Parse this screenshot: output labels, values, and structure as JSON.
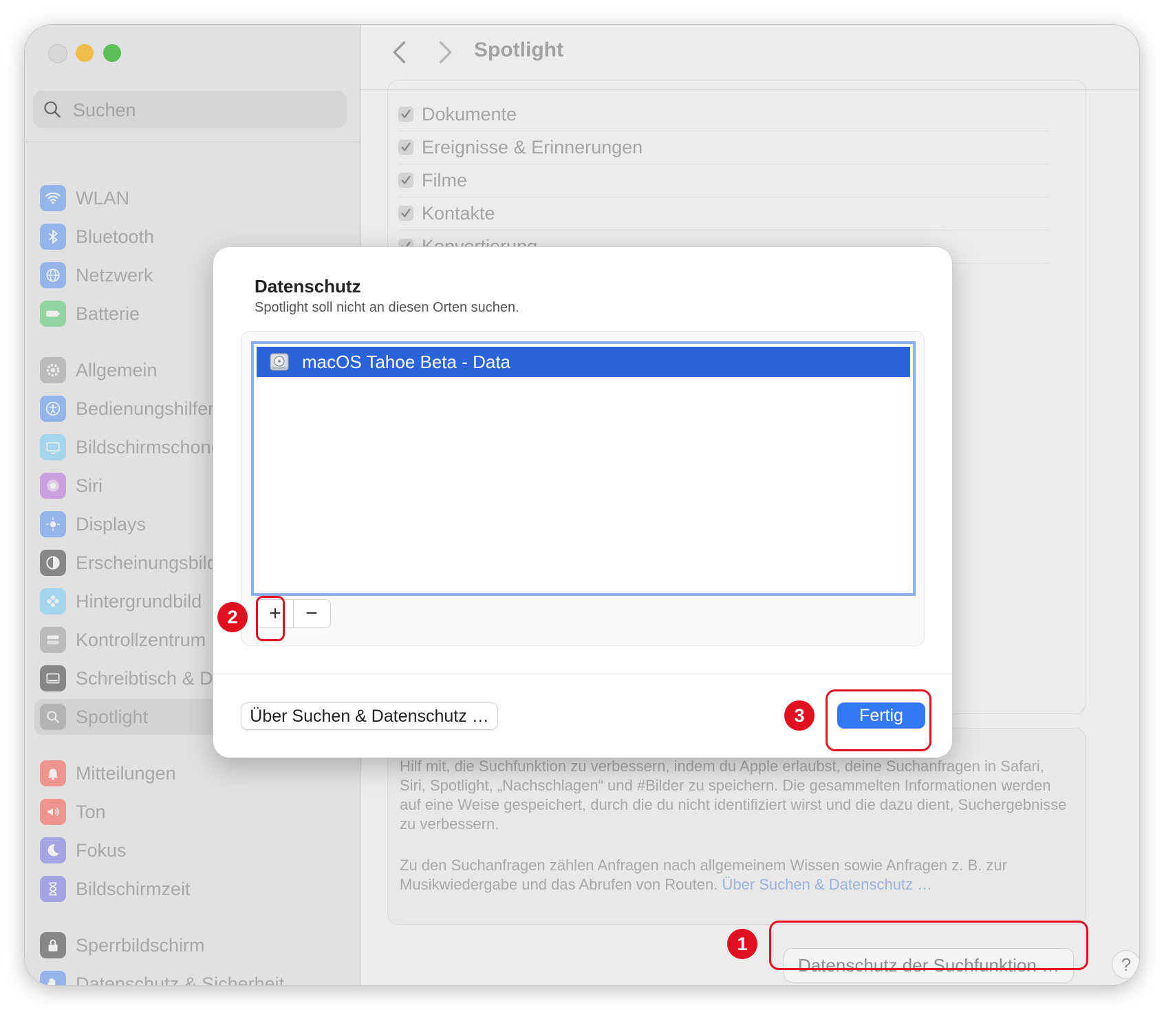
{
  "sidebar": {
    "search_placeholder": "Suchen",
    "items": [
      {
        "label": "WLAN",
        "icon": "wifi-icon",
        "color": "#3b82f6"
      },
      {
        "label": "Bluetooth",
        "icon": "bluetooth-icon",
        "color": "#3b82f6"
      },
      {
        "label": "Netzwerk",
        "icon": "globe-icon",
        "color": "#3b82f6"
      },
      {
        "label": "Batterie",
        "icon": "battery-icon",
        "color": "#34c759"
      },
      {
        "label": "Allgemein",
        "icon": "gear-icon",
        "color": "#8e8e93"
      },
      {
        "label": "Bedienungshilfen",
        "icon": "accessibility-icon",
        "color": "#3b82f6"
      },
      {
        "label": "Bildschirmschoner",
        "icon": "screensaver-icon",
        "color": "#5ac8fa"
      },
      {
        "label": "Siri",
        "icon": "siri-icon",
        "color": "#af52de"
      },
      {
        "label": "Displays",
        "icon": "sun-icon",
        "color": "#3b82f6"
      },
      {
        "label": "Erscheinungsbild",
        "icon": "appearance-icon",
        "color": "#1c1c1e"
      },
      {
        "label": "Hintergrundbild",
        "icon": "flower-icon",
        "color": "#5ac8fa"
      },
      {
        "label": "Kontrollzentrum",
        "icon": "toggles-icon",
        "color": "#8e8e93"
      },
      {
        "label": "Schreibtisch & Dock",
        "icon": "dock-icon",
        "color": "#1c1c1e"
      },
      {
        "label": "Spotlight",
        "icon": "magnifier-icon",
        "color": "#8e8e93"
      },
      {
        "label": "Mitteilungen",
        "icon": "bell-icon",
        "color": "#ff3b30"
      },
      {
        "label": "Ton",
        "icon": "speaker-icon",
        "color": "#ff3b30"
      },
      {
        "label": "Fokus",
        "icon": "moon-icon",
        "color": "#5e5ce6"
      },
      {
        "label": "Bildschirmzeit",
        "icon": "hourglass-icon",
        "color": "#5e5ce6"
      },
      {
        "label": "Sperrbildschirm",
        "icon": "lock-icon",
        "color": "#1c1c1e"
      },
      {
        "label": "Datenschutz & Sicherheit",
        "icon": "hand-icon",
        "color": "#3b82f6"
      }
    ]
  },
  "content": {
    "title": "Spotlight",
    "categories": [
      "Dokumente",
      "Ereignisse & Erinnerungen",
      "Filme",
      "Kontakte",
      "Konvertierung"
    ],
    "help_text_1": "Hilf mit, die Suchfunktion zu verbessern, indem du Apple erlaubst, deine Suchanfragen in Safari, Siri, Spotlight, „Nachschlagen“ und #Bilder zu speichern. Die gesammelten Informationen werden auf eine Weise gespeichert, durch die du nicht identifiziert wirst und die dazu dient, Suchergebnisse zu verbessern.",
    "help_text_2": "Zu den Suchanfragen zählen Anfragen nach allgemeinem Wissen sowie Anfragen z. B. zur Musikwiedergabe und das Abrufen von Routen.",
    "help_link": "Über Suchen & Datenschutz …",
    "privacy_button": "Datenschutz der Suchfunktion …",
    "help_button": "?"
  },
  "dialog": {
    "title": "Datenschutz",
    "subtitle": "Spotlight soll nicht an diesen Orten suchen.",
    "list": [
      "macOS Tahoe Beta - Data"
    ],
    "add": "+",
    "remove": "−",
    "about_button": "Über Suchen & Datenschutz …",
    "done_button": "Fertig"
  },
  "annotations": {
    "badges": [
      "1",
      "2",
      "3"
    ],
    "color": "#e01020"
  }
}
